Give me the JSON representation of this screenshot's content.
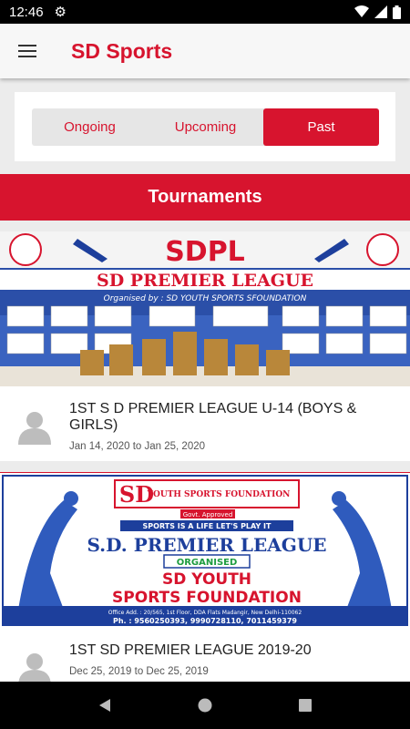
{
  "status_bar": {
    "time": "12:46"
  },
  "app_bar": {
    "title": "SD Sports"
  },
  "tabs": [
    {
      "label": "Ongoing",
      "active": false
    },
    {
      "label": "Upcoming",
      "active": false
    },
    {
      "label": "Past",
      "active": true
    }
  ],
  "section": {
    "title": "Tournaments"
  },
  "tournaments": [
    {
      "title": "1ST S D PREMIER LEAGUE U-14 (BOYS & GIRLS)",
      "start": "Jan 14, 2020",
      "end": "Jan 25, 2020",
      "to": "to",
      "banner": {
        "headline": "SDPL",
        "subline": "SD PREMIER LEAGUE",
        "organiser": "Organised by : SD YOUTH SPORTS SFOUNDATION"
      }
    },
    {
      "title": "1ST SD PREMIER LEAGUE 2019-20",
      "start": "Dec 25, 2019",
      "end": "Dec 25, 2019",
      "to": "to",
      "banner": {
        "logo": "SD",
        "logo_text": "YOUTH SPORTS FOUNDATION",
        "approved": "Govt. Approved",
        "slogan": "SPORTS IS A LIFE LET'S PLAY IT",
        "league": "S.D. PREMIER LEAGUE",
        "organised": "ORGANISED",
        "org1": "SD YOUTH",
        "org2": "SPORTS FOUNDATION",
        "address": "Office Add. : 20/565, 1st Floor, DDA Flats Madangir, New Delhi-110062",
        "phone": "Ph. : 9560250393, 9990728110, 7011459379"
      }
    }
  ],
  "colors": {
    "accent": "#d7142e",
    "banner_blue": "#1d3f9c"
  }
}
